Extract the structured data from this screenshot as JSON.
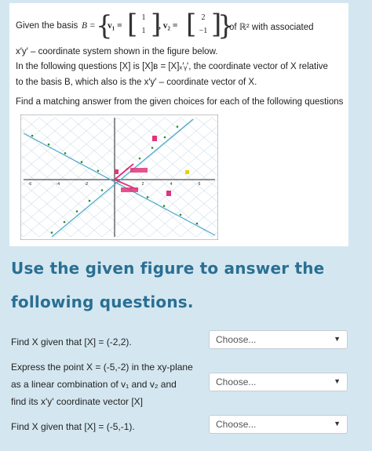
{
  "problem": {
    "line1_prefix": "Given the basis",
    "basis_symbol": "B =",
    "v1_label": "v₁ =",
    "v1": [
      "1",
      "1"
    ],
    "v2_label": ", v₂ =",
    "v2": [
      "2",
      "−1"
    ],
    "line1_suffix": "of ℝ² with associated",
    "line2": "x′y′ – coordinate system shown in the figure below.",
    "line3": "In the following questions [X] is [X]ʙ = [X]ₓ′ᵧ′,  the coordinate vector of X relative",
    "line4": "to the basis B, which also is the x′y′ – coordinate vector of X.",
    "line5": "Find a matching answer from the given choices for each of the following questions"
  },
  "figure": {
    "grid_color": "#b9cfe0",
    "axis_color": "#222222",
    "line_color": "#4aa6c8",
    "marker_color": "#e0357a",
    "ticks": [
      "-6",
      "-4",
      "-2",
      "2",
      "4",
      "6"
    ]
  },
  "heading": {
    "line1": "Use the given figure to answer the",
    "line2": "following questions."
  },
  "questions": [
    {
      "text": "Find X given that  [X] = (-2,2).",
      "selected": "Choose..."
    },
    {
      "text_lines": [
        "Express the point X = (-5,-2) in the xy-plane",
        "as a linear combination of  v₁  and  v₂ and",
        "find its x'y' coordinate vector [X]"
      ],
      "selected": "Choose..."
    },
    {
      "text": "Find X given that  [X] = (-5,-1).",
      "selected": "Choose..."
    }
  ]
}
